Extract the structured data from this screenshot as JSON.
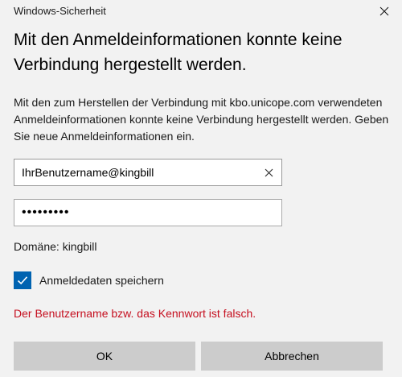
{
  "window": {
    "title": "Windows-Sicherheit"
  },
  "heading": "Mit den Anmeldeinformationen konnte keine Verbindung hergestellt werden.",
  "message": "Mit den zum Herstellen der Verbindung mit kbo.unicope.com verwendeten Anmeldeinformationen konnte keine Verbindung hergestellt werden. Geben Sie neue Anmeldeinformationen ein.",
  "username": {
    "value": "IhrBenutzername@kingbill"
  },
  "password": {
    "masked_value": "•••••••••"
  },
  "domain_text": "Domäne: kingbill",
  "remember": {
    "label": "Anmeldedaten speichern",
    "checked": true
  },
  "error_text": "Der Benutzername bzw. das Kennwort ist falsch.",
  "buttons": {
    "ok": "OK",
    "cancel": "Abbrechen"
  },
  "colors": {
    "background": "#f2f2f2",
    "accent": "#0063b1",
    "error": "#c50f1f",
    "button": "#cccccc"
  },
  "icons": {
    "close": "close-icon",
    "clear": "clear-icon",
    "checkmark": "checkmark-icon"
  }
}
